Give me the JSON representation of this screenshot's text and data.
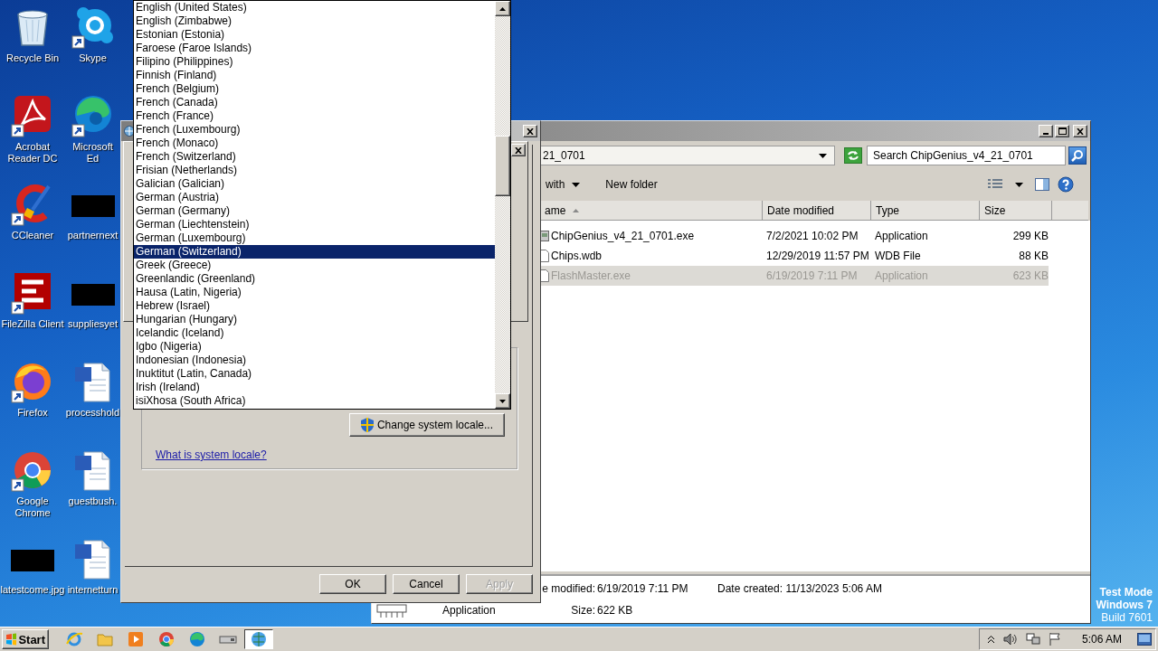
{
  "desktop_icons": [
    {
      "label": "Recycle Bin",
      "kind": "recycle",
      "shortcut": false
    },
    {
      "label": "Skype",
      "kind": "skype",
      "shortcut": true
    },
    {
      "label": "Acrobat Reader DC",
      "kind": "acrobat",
      "shortcut": true
    },
    {
      "label": "Microsoft Ed",
      "kind": "edge",
      "shortcut": true
    },
    {
      "label": "CCleaner",
      "kind": "ccleaner",
      "shortcut": true
    },
    {
      "label": "partnernext",
      "kind": "thumbnail",
      "shortcut": false
    },
    {
      "label": "FileZilla Client",
      "kind": "filezilla",
      "shortcut": true
    },
    {
      "label": "suppliesyet",
      "kind": "thumbnail",
      "shortcut": false
    },
    {
      "label": "Firefox",
      "kind": "firefox",
      "shortcut": true
    },
    {
      "label": "processhold",
      "kind": "word",
      "shortcut": false
    },
    {
      "label": "Google Chrome",
      "kind": "chrome",
      "shortcut": true
    },
    {
      "label": "guestbush.",
      "kind": "word",
      "shortcut": false
    },
    {
      "label": "latestcome.jpg",
      "kind": "thumbnail",
      "shortcut": false
    },
    {
      "label": "internetturn",
      "kind": "word",
      "shortcut": false
    }
  ],
  "explorer": {
    "address": "21_0701",
    "search_placeholder": "Search ChipGenius_v4_21_0701",
    "toolbar": [
      "with",
      "New folder"
    ],
    "columns": [
      "ame",
      "Date modified",
      "Type",
      "Size"
    ],
    "files": [
      {
        "name": "ChipGenius_v4_21_0701.exe",
        "date": "7/2/2021 10:02 PM",
        "type": "Application",
        "size": "299 KB",
        "kind": "exe",
        "selected": false
      },
      {
        "name": "Chips.wdb",
        "date": "12/29/2019 11:57 PM",
        "type": "WDB File",
        "size": "88 KB",
        "kind": "file",
        "selected": false
      },
      {
        "name": "FlashMaster.exe",
        "date": "6/19/2019 7:11 PM",
        "type": "Application",
        "size": "623 KB",
        "kind": "file",
        "selected": true
      }
    ],
    "details": {
      "modified_label": "e modified:",
      "modified": "6/19/2019 7:11 PM",
      "created_label": "Date created:",
      "created": "11/13/2023 5:06 AM",
      "type": "Application",
      "size_label": "Size:",
      "size": "622 KB"
    }
  },
  "region_dialog": {
    "change_locale_button": "Change system locale...",
    "help_link": "What is system locale?",
    "buttons": [
      {
        "label": "OK",
        "disabled": false
      },
      {
        "label": "Cancel",
        "disabled": false
      },
      {
        "label": "Apply",
        "disabled": true
      }
    ]
  },
  "locale_dropdown": {
    "items": [
      {
        "label": "English (United States)",
        "selected": false
      },
      {
        "label": "English (Zimbabwe)",
        "selected": false
      },
      {
        "label": "Estonian (Estonia)",
        "selected": false
      },
      {
        "label": "Faroese (Faroe Islands)",
        "selected": false
      },
      {
        "label": "Filipino (Philippines)",
        "selected": false
      },
      {
        "label": "Finnish (Finland)",
        "selected": false
      },
      {
        "label": "French (Belgium)",
        "selected": false
      },
      {
        "label": "French (Canada)",
        "selected": false
      },
      {
        "label": "French (France)",
        "selected": false
      },
      {
        "label": "French (Luxembourg)",
        "selected": false
      },
      {
        "label": "French (Monaco)",
        "selected": false
      },
      {
        "label": "French (Switzerland)",
        "selected": false
      },
      {
        "label": "Frisian (Netherlands)",
        "selected": false
      },
      {
        "label": "Galician (Galician)",
        "selected": false
      },
      {
        "label": "German (Austria)",
        "selected": false
      },
      {
        "label": "German (Germany)",
        "selected": false
      },
      {
        "label": "German (Liechtenstein)",
        "selected": false
      },
      {
        "label": "German (Luxembourg)",
        "selected": false
      },
      {
        "label": "German (Switzerland)",
        "selected": true
      },
      {
        "label": "Greek (Greece)",
        "selected": false
      },
      {
        "label": "Greenlandic (Greenland)",
        "selected": false
      },
      {
        "label": "Hausa (Latin, Nigeria)",
        "selected": false
      },
      {
        "label": "Hebrew (Israel)",
        "selected": false
      },
      {
        "label": "Hungarian (Hungary)",
        "selected": false
      },
      {
        "label": "Icelandic (Iceland)",
        "selected": false
      },
      {
        "label": "Igbo (Nigeria)",
        "selected": false
      },
      {
        "label": "Indonesian (Indonesia)",
        "selected": false
      },
      {
        "label": "Inuktitut (Latin, Canada)",
        "selected": false
      },
      {
        "label": "Irish (Ireland)",
        "selected": false
      },
      {
        "label": "isiXhosa (South Africa)",
        "selected": false
      }
    ]
  },
  "os_notice": [
    "Test Mode",
    "Windows 7",
    "Build 7601"
  ],
  "taskbar": {
    "start": "Start",
    "apps": [
      {
        "kind": "ie",
        "selected": false
      },
      {
        "kind": "folder",
        "selected": false
      },
      {
        "kind": "media",
        "selected": false
      },
      {
        "kind": "chrome",
        "selected": false
      },
      {
        "kind": "edge",
        "selected": false
      },
      {
        "kind": "device",
        "selected": false
      },
      {
        "kind": "network",
        "selected": true
      }
    ],
    "clock": "5:06 AM"
  }
}
